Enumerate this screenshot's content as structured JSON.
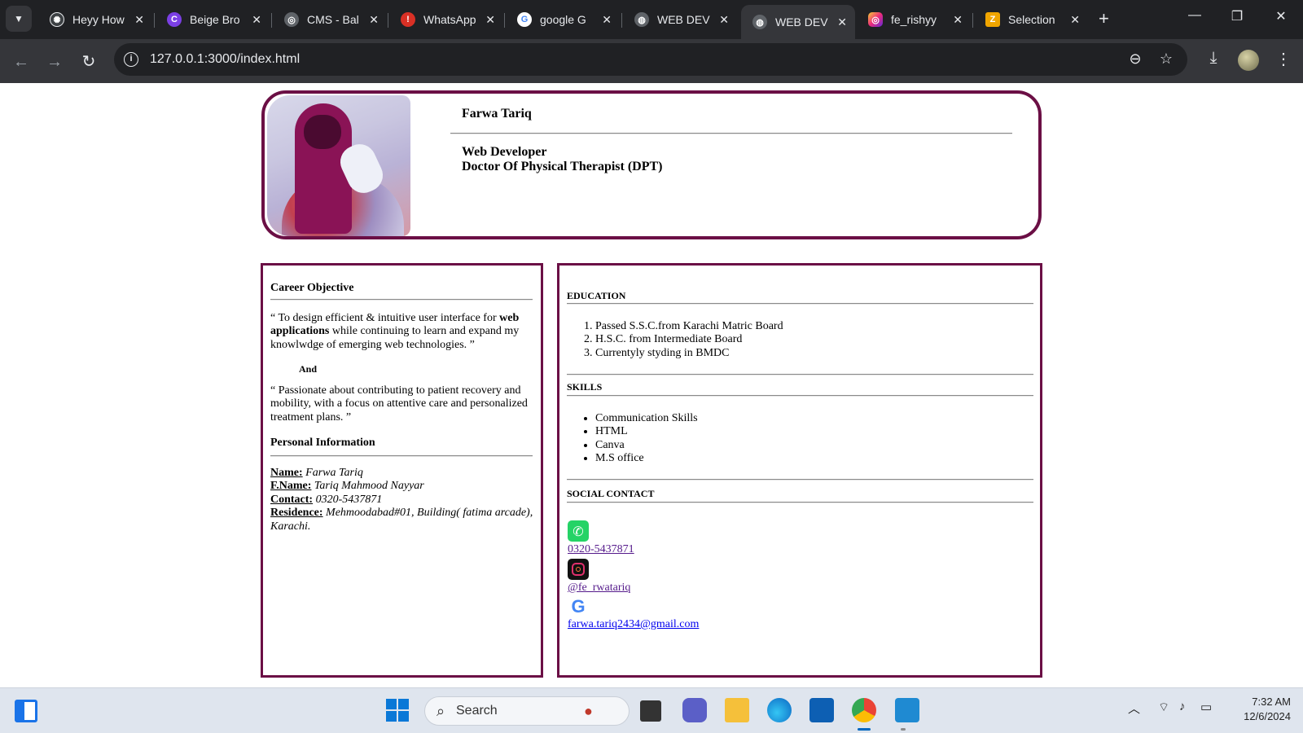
{
  "browser": {
    "tabs": [
      {
        "title": "Heyy How",
        "favicon": "chatgpt-icon",
        "color": "#3c4043"
      },
      {
        "title": "Beige Bro",
        "favicon": "canva-icon",
        "color": "#7b3fe4"
      },
      {
        "title": "CMS - Bal",
        "favicon": "cms-icon",
        "color": "#5f6368"
      },
      {
        "title": "WhatsApp",
        "favicon": "whatsapp-alert-icon",
        "color": "#d93025"
      },
      {
        "title": "google G",
        "favicon": "google-icon",
        "color": "#4285f4"
      },
      {
        "title": "WEB DEV",
        "favicon": "globe-icon",
        "color": "#5f6368"
      },
      {
        "title": "WEB DEV",
        "favicon": "globe-icon",
        "color": "#5f6368",
        "active": true
      },
      {
        "title": "fe_rishyy",
        "favicon": "instagram-icon",
        "color": "#e1306c"
      },
      {
        "title": "Selection",
        "favicon": "zoho-icon",
        "color": "#f0a500"
      }
    ],
    "url": "127.0.0.1:3000/index.html"
  },
  "resume": {
    "name": "Farwa Tariq",
    "role_1": "Web Developer",
    "role_2": "Doctor Of Physical Therapist (DPT)",
    "career_objective": {
      "title": "Career Objective",
      "para1_pre": "“ To design efficient & intuitive user interface for ",
      "para1_bold": "web applications",
      "para1_post": " while continuing to learn and expand my knowlwdge of emerging web technologies. ”",
      "and": "And",
      "para2": "“ Passionate about contributing to patient recovery and mobility, with a focus on attentive care and personalized treatment plans. ”"
    },
    "personal_info": {
      "title": "Personal Information",
      "name_label": "Name:",
      "name_value": "Farwa Tariq",
      "fname_label": "F.Name:",
      "fname_value": "Tariq Mahmood Nayyar",
      "contact_label": "Contact:",
      "contact_value": "0320-5437871",
      "residence_label": "Residence:",
      "residence_value": "Mehmoodabad#01, Building( fatima arcade), Karachi."
    },
    "education": {
      "title": "EDUCATION",
      "items": [
        "Passed S.S.C.from Karachi Matric Board",
        "H.S.C. from Intermediate Board",
        "Currentyly styding in BMDC"
      ]
    },
    "skills": {
      "title": "SKILLS",
      "items": [
        "Communication Skills",
        "HTML",
        "Canva",
        "M.S office"
      ]
    },
    "social": {
      "title": "SOCIAL CONTACT",
      "whatsapp": "0320-5437871",
      "instagram": "@fe_rwatariq",
      "email": "farwa.tariq2434@gmail.com"
    }
  },
  "taskbar": {
    "search_label": "Search",
    "time": "7:32 AM",
    "date": "12/6/2024"
  },
  "colors": {
    "accent": "#6b0f45",
    "whatsapp": "#25d366"
  }
}
